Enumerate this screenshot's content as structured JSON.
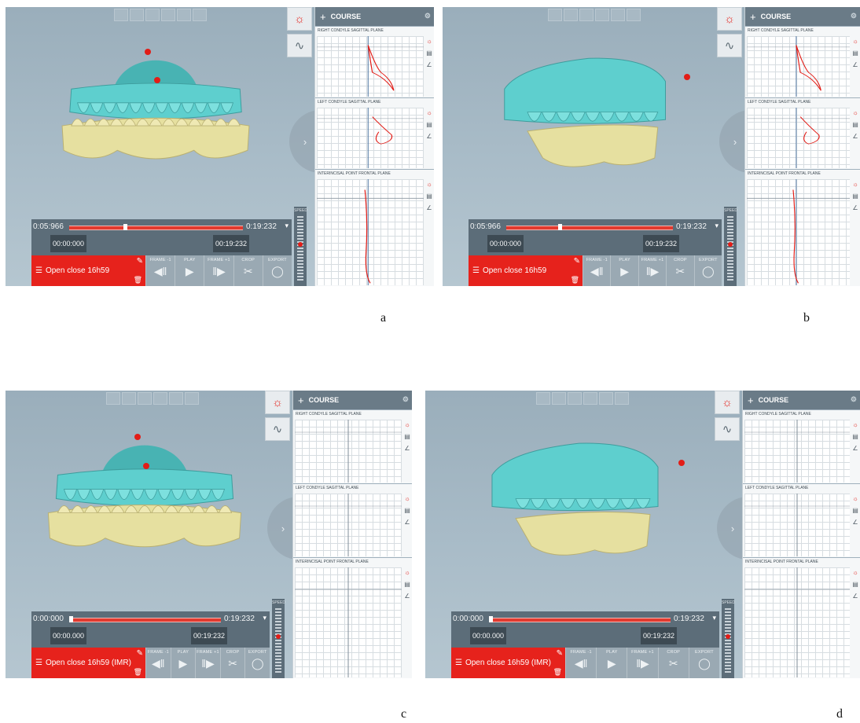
{
  "course_title": "COURSE",
  "planes": [
    "RIGHT CONDYLE SAGITTAL PLANE",
    "LEFT CONDYLE SAGITTAL PLANE",
    "INTERINCISAL POINT FRONTAL PLANE"
  ],
  "buttons": {
    "frame_prev": "FRAME -1",
    "play": "PLAY",
    "frame_next": "FRAME +1",
    "crop": "CROP",
    "export": "EXPORT"
  },
  "speed_label": "SPEED",
  "icons": {
    "tool_1": "jaw-tracking-icon",
    "tool_2": "curve-graph-icon",
    "next": "chevron-right-icon",
    "menu": "list-icon",
    "edit": "pencil-icon",
    "delete": "trash-icon",
    "plane_1": "jaw-tracking-icon",
    "plane_2": "layers-icon",
    "plane_3": "angle-icon",
    "gear": "gear-icon"
  },
  "colors": {
    "accent_red": "#e6221c",
    "upper_teeth": "#5ecfce",
    "lower_teeth": "#e6e0a0",
    "course_header": "#6a7b87"
  },
  "panels": [
    {
      "label": "a",
      "current_time": "0:05:966",
      "end_time": "0:19:232",
      "start_box": "00:00:000",
      "end_box": "00:19:232",
      "clip_name": "Open close 16h59",
      "progress": 0.31
    },
    {
      "label": "b",
      "current_time": "0:05:966",
      "end_time": "0:19:232",
      "start_box": "00:00:000",
      "end_box": "00:19:232",
      "clip_name": "Open close 16h59",
      "progress": 0.31
    },
    {
      "label": "c",
      "current_time": "0:00:000",
      "end_time": "0:19:232",
      "start_box": "00:00.000",
      "end_box": "00:19:232",
      "clip_name": "Open close 16h59 (IMR)",
      "progress": 0.0
    },
    {
      "label": "d",
      "current_time": "0:00:000",
      "end_time": "0:19:232",
      "start_box": "00:00.000",
      "end_box": "00:19:232",
      "clip_name": "Open close 16h59 (IMR)",
      "progress": 0.0
    }
  ]
}
